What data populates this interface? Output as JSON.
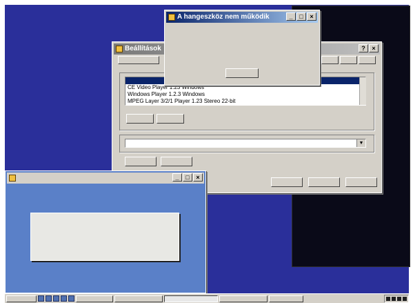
{
  "console": {
    "lines": [
      "",
      "",
      "",
      "",
      "",
      "",
      "",
      "",
      "",
      "",
      "",
      "",
      "",
      "",
      "",
      "",
      "",
      "",
      "",
      "",
      "",
      "",
      "",
      "",
      "",
      "",
      "",
      "",
      "",
      "",
      "",
      "",
      "",
      ""
    ]
  },
  "main_dialog": {
    "title": "Beállítások",
    "tabs": [
      "",
      "",
      "",
      ""
    ],
    "group1_label": "",
    "list_header": "",
    "list_items": [
      "CE Video Player 1.23   Windows",
      "Windows Player 1.2.3   Windows",
      "MPEG Layer 3/2/1 Player 1.23   Stereo 22-bit"
    ],
    "btn_add": "",
    "btn_remove": "",
    "btn_properties": "",
    "group2_label": "",
    "combo_value": "",
    "btn_left1": "",
    "btn_left2": "",
    "ok": "",
    "cancel": "",
    "apply": ""
  },
  "msg_top": {
    "title": "A hangeszköz nem működik",
    "text1": "",
    "text2": "",
    "text3": "",
    "text4": "",
    "ok": ""
  },
  "lower_window": {
    "title": "",
    "msg1": "",
    "msg2": "",
    "btn_yes": "",
    "btn_no": ""
  },
  "taskbar": {
    "start": "",
    "items": [
      "",
      "",
      "",
      "",
      ""
    ]
  }
}
